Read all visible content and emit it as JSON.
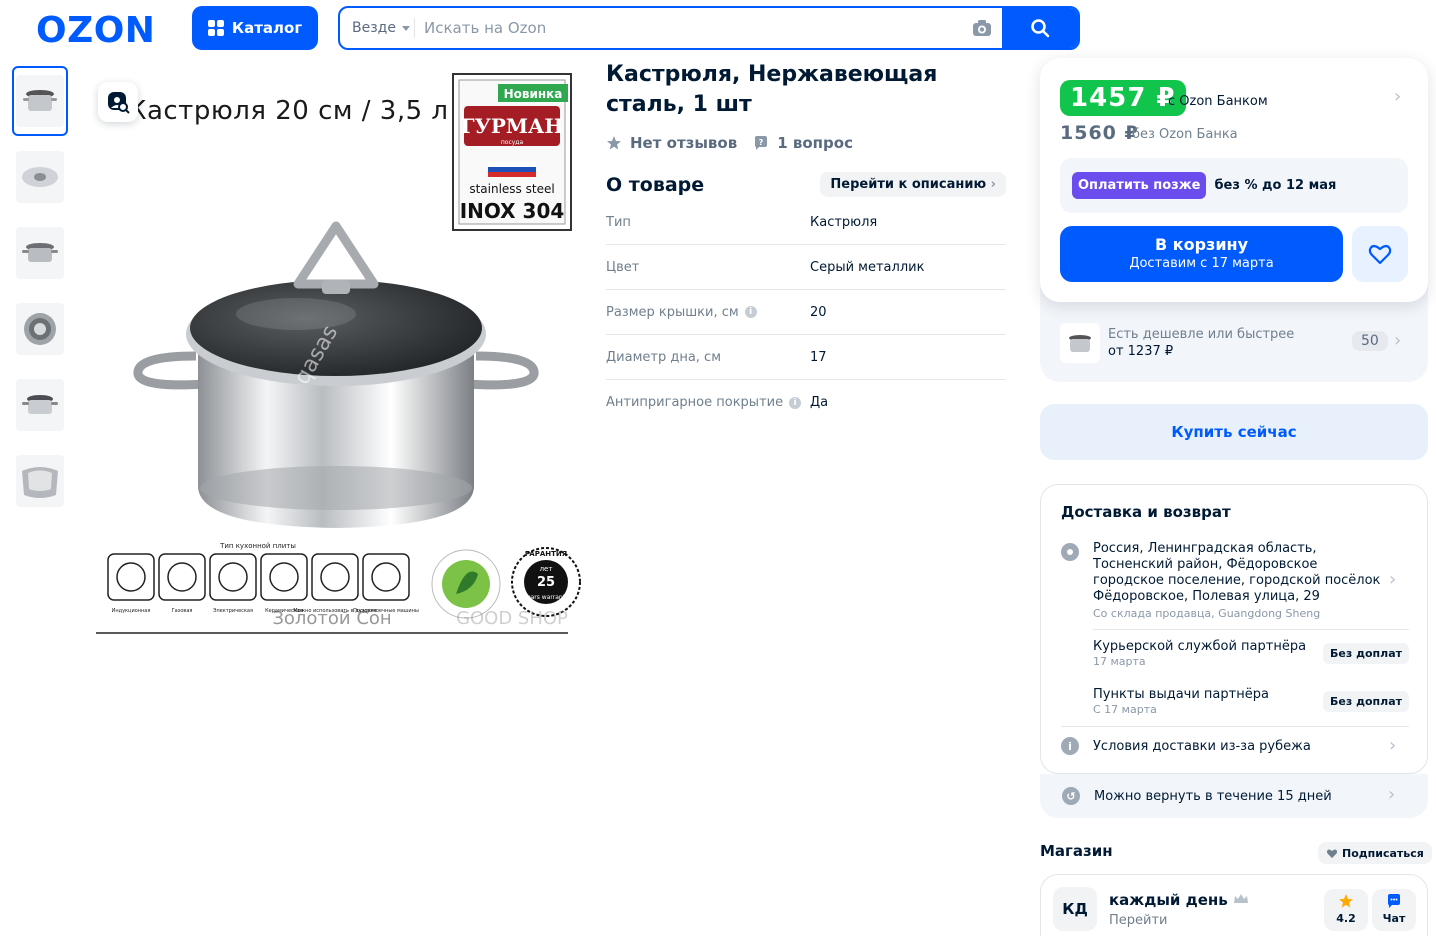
{
  "header": {
    "logo": "OZON",
    "catalog_label": "Каталог",
    "search_scope": "Везде",
    "search_placeholder": "Искать на Ozon"
  },
  "gallery": {
    "thumbnail_count": 6,
    "image_caption": "Кастрюля 20 см / 3,5 л",
    "badge_new": "Новинка",
    "brand": "ГУРМАН",
    "brand_sub": "посуда",
    "steel_label": "stainless steel",
    "steel_grade": "INOX 304",
    "stove_types_title": "Тип кухонной плиты",
    "stove_types": [
      "Индукционная",
      "Газовая",
      "Электрическая",
      "Керамическая",
      "Можно использовать в духовке",
      "Посудомоечные машины"
    ],
    "warranty_label": "ГАРАНТИЯ",
    "warranty_years": "25",
    "warranty_unit": "лет",
    "warranty_en": "years warranty",
    "watermark_1": "Золотой Сон",
    "watermark_2": "GOOD SHOP",
    "watermark_diag": "qasas"
  },
  "product": {
    "title": "Кастрюля, Нержавеющая сталь, 1 шт",
    "reviews": "Нет отзывов",
    "questions": "1 вопрос",
    "about_heading": "О товаре",
    "to_description": "Перейти к описанию",
    "specs": [
      {
        "key": "Тип",
        "value": "Кастрюля",
        "info": false
      },
      {
        "key": "Цвет",
        "value": "Серый металлик",
        "info": false
      },
      {
        "key": "Размер крышки, см",
        "value": "20",
        "info": true
      },
      {
        "key": "Диаметр дна, см",
        "value": "17",
        "info": false
      },
      {
        "key": "Антипригарное покрытие",
        "value": "Да",
        "info": true
      }
    ]
  },
  "price": {
    "bank_price": "1457 ₽",
    "bank_label": "с Ozon Банком",
    "regular_price": "1560 ₽",
    "regular_label": "без Ozon Банка",
    "pay_later_tag": "Оплатить позже",
    "pay_later_text": "без % до 12 мая",
    "cart_label": "В корзину",
    "cart_sub": "Доставим с 17 марта",
    "cheaper_label": "Есть дешевле или быстрее",
    "cheaper_from": "от 1237 ₽",
    "cheaper_count": "50",
    "buy_now": "Купить сейчас"
  },
  "delivery": {
    "heading": "Доставка и возврат",
    "address": "Россия, Ленинградская область, Тосненский район, Фёдоровское городское поселение, городской посёлок Фёдоровское, Полевая улица, 29",
    "warehouse": "Со склада продавца, Guangdong Sheng",
    "options": [
      {
        "name": "Курьерской службой партнёра",
        "date": "17 марта",
        "badge": "Без доплат"
      },
      {
        "name": "Пункты выдачи партнёра",
        "date": "С 17 марта",
        "badge": "Без доплат"
      }
    ],
    "abroad": "Условия доставки из-за рубежа",
    "return": "Можно вернуть в течение 15 дней"
  },
  "shop": {
    "heading": "Магазин",
    "subscribe": "Подписаться",
    "avatar": "КД",
    "name": "каждый день",
    "go": "Перейти",
    "rating": "4.2",
    "chat": "Чат"
  },
  "colors": {
    "brand_blue": "#005bff",
    "price_green": "#10c44c",
    "pay_later_purple": "#6b4cec"
  }
}
